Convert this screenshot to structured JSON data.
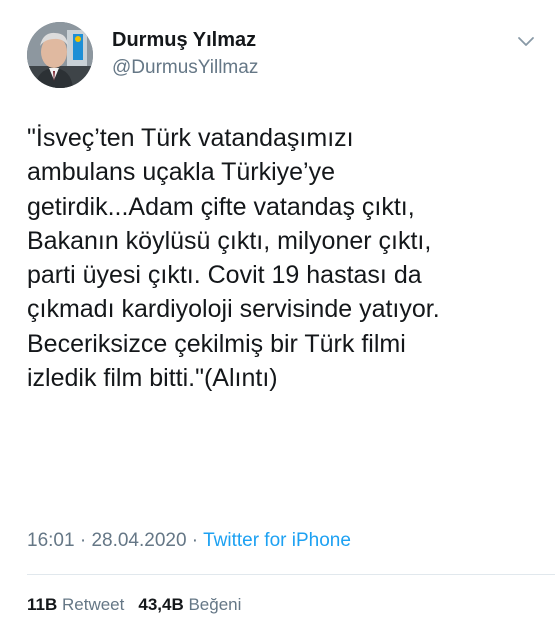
{
  "tweet": {
    "author": {
      "display_name": "Durmuş Yılmaz",
      "handle": "@DurmusYillmaz",
      "avatar_icon": "user-avatar-photo"
    },
    "menu_icon": "chevron-down-icon",
    "text": "\"İsveç’ten Türk vatandaşımızı\nambulans uçakla Türkiye’ye\ngetirdik...Adam çifte vatandaş çıktı,\nBakanın köylüsü çıktı, milyoner çıktı,\nparti üyesi çıktı. Covit 19 hastası da\nçıkmadı kardiyoloji servisinde yatıyor.\nBeceriksizce çekilmiş bir Türk filmi\nizledik film bitti.\"(Alıntı)",
    "time": "16:01",
    "separator1": " · ",
    "date": "28.04.2020",
    "separator2": " · ",
    "source": "Twitter for iPhone",
    "stats": {
      "retweets_count": "11B",
      "retweets_label": "Retweet",
      "likes_count": "43,4B",
      "likes_label": "Beğeni"
    },
    "colors": {
      "text": "#14171a",
      "secondary": "#657786",
      "link": "#1da1f2",
      "divider": "#e1e8ed"
    }
  }
}
